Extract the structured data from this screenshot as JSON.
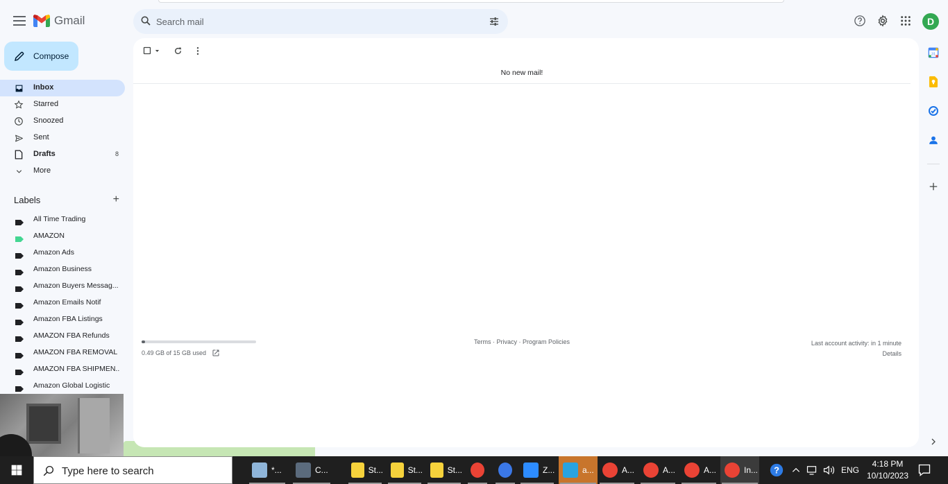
{
  "app": {
    "name": "Gmail",
    "avatar_initial": "D"
  },
  "search": {
    "placeholder": "Search mail"
  },
  "compose": {
    "label": "Compose"
  },
  "nav": {
    "items": [
      {
        "label": "Inbox",
        "count": "",
        "icon": "inbox-icon",
        "active": true
      },
      {
        "label": "Starred",
        "count": "",
        "icon": "star-icon"
      },
      {
        "label": "Snoozed",
        "count": "",
        "icon": "clock-icon"
      },
      {
        "label": "Sent",
        "count": "",
        "icon": "send-icon"
      },
      {
        "label": "Drafts",
        "count": "8",
        "icon": "draft-icon"
      },
      {
        "label": "More",
        "count": "",
        "icon": "chevron-down-icon"
      }
    ]
  },
  "labels": {
    "title": "Labels",
    "items": [
      {
        "label": "All Time Trading",
        "color": "#202124"
      },
      {
        "label": "AMAZON",
        "color": "#43d692"
      },
      {
        "label": "Amazon Ads",
        "color": "#202124"
      },
      {
        "label": "Amazon Business",
        "color": "#202124"
      },
      {
        "label": "Amazon Buyers Messag...",
        "color": "#202124"
      },
      {
        "label": "Amazon Emails Notif",
        "color": "#202124"
      },
      {
        "label": "Amazon FBA Listings",
        "color": "#202124"
      },
      {
        "label": "AMAZON FBA Refunds",
        "color": "#202124"
      },
      {
        "label": "AMAZON FBA REMOVAL",
        "color": "#202124"
      },
      {
        "label": "AMAZON FBA SHIPMEN...",
        "color": "#202124"
      },
      {
        "label": "Amazon Global Logistic",
        "color": "#202124"
      }
    ]
  },
  "main": {
    "empty_message": "No new mail!",
    "storage": {
      "text": "0.49 GB of 15 GB used",
      "fraction": 0.033
    },
    "footer": {
      "terms": "Terms",
      "sep1": " · ",
      "privacy": "Privacy",
      "sep2": " · ",
      "policies": "Program Policies"
    },
    "activity": {
      "text": "Last account activity: in 1 minute",
      "details": "Details"
    }
  },
  "taskbar": {
    "search_placeholder": "Type here to search",
    "apps": [
      {
        "label": "*...",
        "color": "#8fb5d9"
      },
      {
        "label": "C...",
        "color": "#5b6b7d"
      },
      {
        "label": "St...",
        "color": "#f6d23c"
      },
      {
        "label": "St...",
        "color": "#f6d23c"
      },
      {
        "label": "St...",
        "color": "#f6d23c"
      },
      {
        "label": "",
        "color": "#ea4335"
      },
      {
        "label": "",
        "color": "#3b78e7"
      },
      {
        "label": "Z...",
        "color": "#2d8cff"
      },
      {
        "label": "a...",
        "color": "#2aa3e0"
      },
      {
        "label": "A...",
        "color": "#ea4335"
      },
      {
        "label": "A...",
        "color": "#ea4335"
      },
      {
        "label": "A...",
        "color": "#ea4335"
      },
      {
        "label": "In...",
        "color": "#ea4335"
      }
    ],
    "lang": "ENG",
    "time": "4:18 PM",
    "date": "10/10/2023"
  }
}
